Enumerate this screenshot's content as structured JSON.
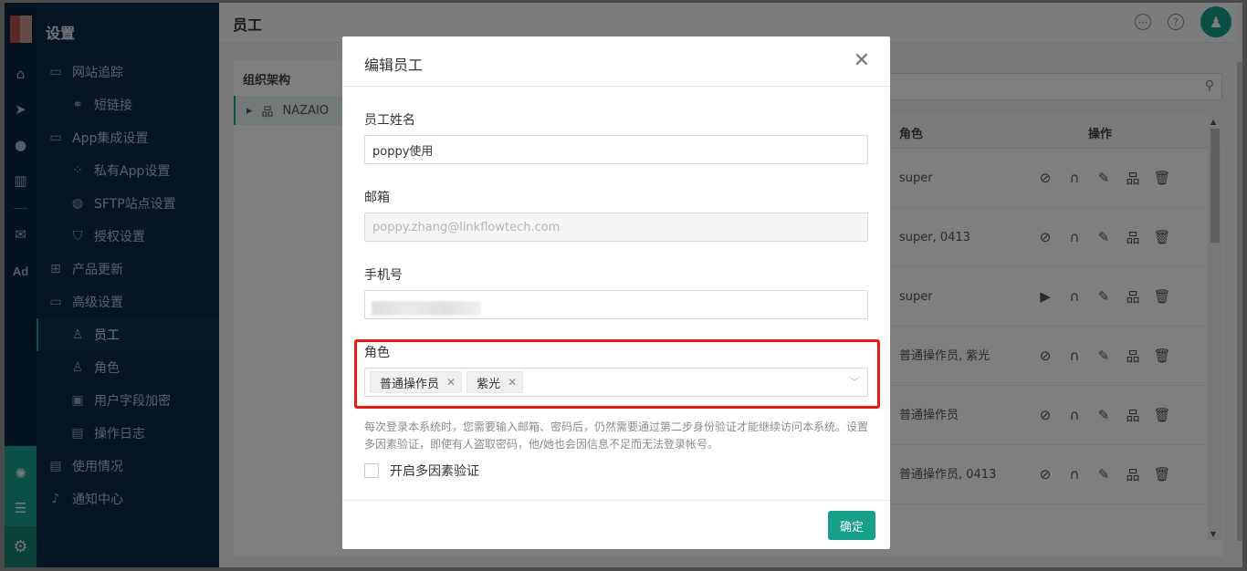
{
  "sidebar": {
    "title": "设置",
    "items": [
      {
        "label": "网站追踪",
        "icon": "folder-icon"
      },
      {
        "label": "短链接",
        "icon": "link-icon"
      },
      {
        "label": "App集成设置",
        "icon": "folder-icon"
      },
      {
        "label": "私有App设置",
        "icon": "apps-icon"
      },
      {
        "label": "SFTP站点设置",
        "icon": "globe-icon"
      },
      {
        "label": "授权设置",
        "icon": "shield-icon"
      },
      {
        "label": "产品更新",
        "icon": "grid-icon"
      },
      {
        "label": "高级设置",
        "icon": "folder-icon"
      },
      {
        "label": "员工",
        "icon": "user-icon"
      },
      {
        "label": "角色",
        "icon": "role-icon"
      },
      {
        "label": "用户字段加密",
        "icon": "encrypt-icon"
      },
      {
        "label": "操作日志",
        "icon": "log-icon"
      },
      {
        "label": "使用情况",
        "icon": "usage-icon"
      },
      {
        "label": "通知中心",
        "icon": "bell-icon"
      }
    ]
  },
  "rail": {
    "ad_label": "Ad"
  },
  "header": {
    "title": "员工"
  },
  "org": {
    "title": "组织架构",
    "node": "NAZAIO"
  },
  "table": {
    "headers": {
      "role": "角色",
      "actions": "操作"
    },
    "rows": [
      {
        "role": "super"
      },
      {
        "role": "super, 0413"
      },
      {
        "role": "super"
      },
      {
        "role": "普通操作员, 紫光"
      },
      {
        "role": "普通操作员"
      },
      {
        "role": "普通操作员, 0413"
      }
    ]
  },
  "modal": {
    "title": "编辑员工",
    "name_label": "员工姓名",
    "name_value": "poppy使用",
    "email_label": "邮箱",
    "email_placeholder": "poppy.zhang@linkflowtech.com",
    "phone_label": "手机号",
    "role_label": "角色",
    "roles": [
      "普通操作员",
      "紫光"
    ],
    "help_text": "每次登录本系统时，您需要输入邮箱、密码后，仍然需要通过第二步身份验证才能继续访问本系统。设置多因素验证，即使有人盗取密码，他/她也会因信息不足而无法登录帐号。",
    "mfa_label": "开启多因素验证",
    "ok_label": "确定"
  },
  "colors": {
    "accent": "#17a08c",
    "sidebar": "#0c2947",
    "highlight": "#e8190f"
  }
}
